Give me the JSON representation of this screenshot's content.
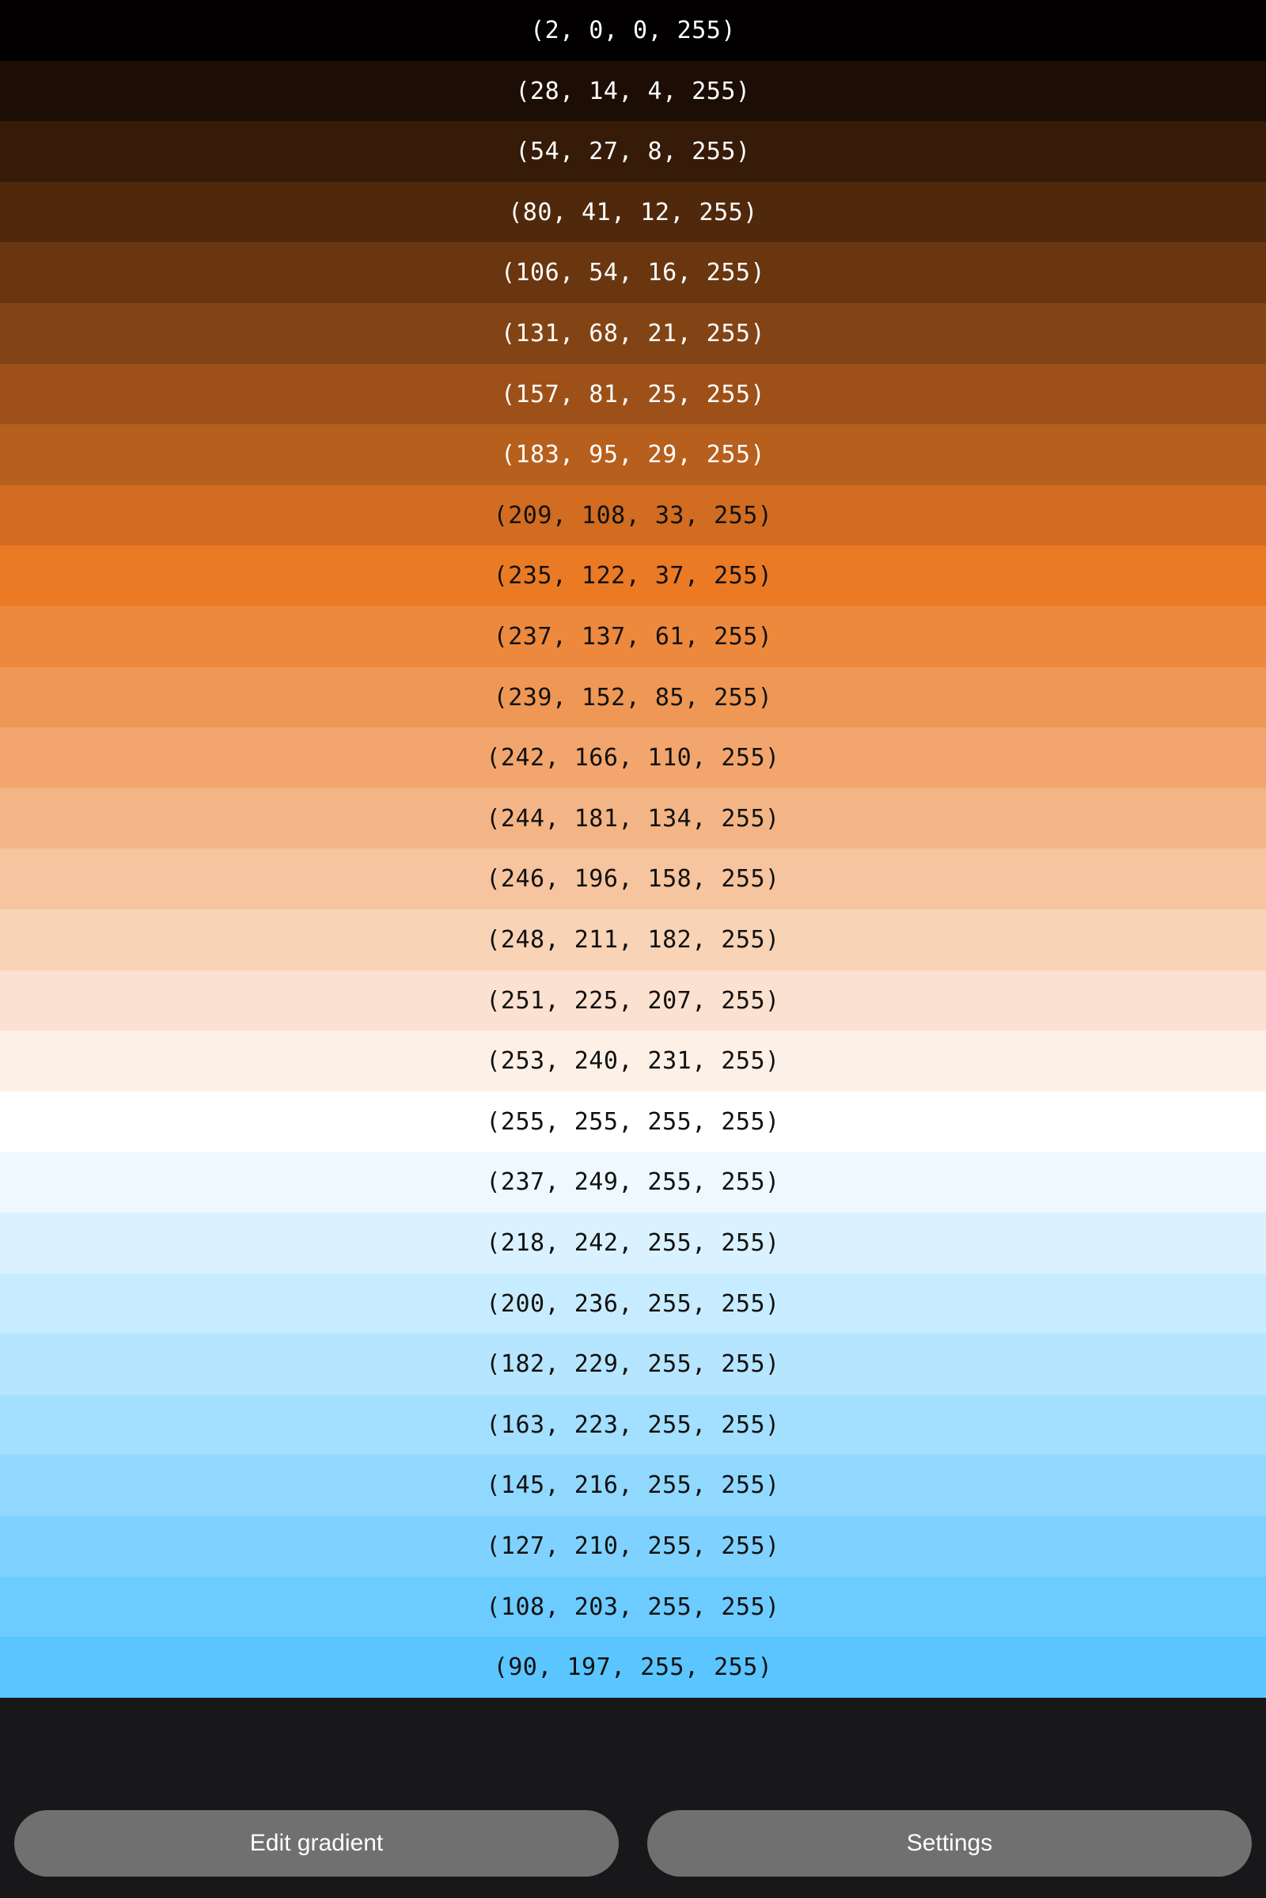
{
  "swatches": [
    {
      "label": "(2, 0, 0, 255)",
      "color": "#020000",
      "text_color": "#ffffff"
    },
    {
      "label": "(28, 14, 4, 255)",
      "color": "#1c0e04",
      "text_color": "#ffffff"
    },
    {
      "label": "(54, 27, 8, 255)",
      "color": "#361b08",
      "text_color": "#ffffff"
    },
    {
      "label": "(80, 41, 12, 255)",
      "color": "#50290c",
      "text_color": "#ffffff"
    },
    {
      "label": "(106, 54, 16, 255)",
      "color": "#6a3610",
      "text_color": "#ffffff"
    },
    {
      "label": "(131, 68, 21, 255)",
      "color": "#834415",
      "text_color": "#ffffff"
    },
    {
      "label": "(157, 81, 25, 255)",
      "color": "#9d5119",
      "text_color": "#ffffff"
    },
    {
      "label": "(183, 95, 29, 255)",
      "color": "#b75f1d",
      "text_color": "#ffffff"
    },
    {
      "label": "(209, 108, 33, 255)",
      "color": "#d16c21",
      "text_color": "#111111"
    },
    {
      "label": "(235, 122, 37, 255)",
      "color": "#eb7a25",
      "text_color": "#111111"
    },
    {
      "label": "(237, 137, 61, 255)",
      "color": "#ed893d",
      "text_color": "#111111"
    },
    {
      "label": "(239, 152, 85, 255)",
      "color": "#ef9855",
      "text_color": "#111111"
    },
    {
      "label": "(242, 166, 110, 255)",
      "color": "#f2a66e",
      "text_color": "#111111"
    },
    {
      "label": "(244, 181, 134, 255)",
      "color": "#f4b586",
      "text_color": "#111111"
    },
    {
      "label": "(246, 196, 158, 255)",
      "color": "#f6c49e",
      "text_color": "#111111"
    },
    {
      "label": "(248, 211, 182, 255)",
      "color": "#f8d3b6",
      "text_color": "#111111"
    },
    {
      "label": "(251, 225, 207, 255)",
      "color": "#fbe1cf",
      "text_color": "#111111"
    },
    {
      "label": "(253, 240, 231, 255)",
      "color": "#fdf0e7",
      "text_color": "#111111"
    },
    {
      "label": "(255, 255, 255, 255)",
      "color": "#ffffff",
      "text_color": "#111111"
    },
    {
      "label": "(237, 249, 255, 255)",
      "color": "#edf9ff",
      "text_color": "#111111"
    },
    {
      "label": "(218, 242, 255, 255)",
      "color": "#daf2ff",
      "text_color": "#111111"
    },
    {
      "label": "(200, 236, 255, 255)",
      "color": "#c8ecff",
      "text_color": "#111111"
    },
    {
      "label": "(182, 229, 255, 255)",
      "color": "#b6e5ff",
      "text_color": "#111111"
    },
    {
      "label": "(163, 223, 255, 255)",
      "color": "#a3dfff",
      "text_color": "#111111"
    },
    {
      "label": "(145, 216, 255, 255)",
      "color": "#91d8ff",
      "text_color": "#111111"
    },
    {
      "label": "(127, 210, 255, 255)",
      "color": "#7fd2ff",
      "text_color": "#111111"
    },
    {
      "label": "(108, 203, 255, 255)",
      "color": "#6ccbff",
      "text_color": "#111111"
    },
    {
      "label": "(90, 197, 255, 255)",
      "color": "#5ac5ff",
      "text_color": "#111111"
    }
  ],
  "buttons": {
    "edit_gradient": "Edit gradient",
    "settings": "Settings"
  },
  "colors": {
    "background": "#18181a",
    "button_bg": "#707070",
    "button_text": "#ffffff"
  }
}
